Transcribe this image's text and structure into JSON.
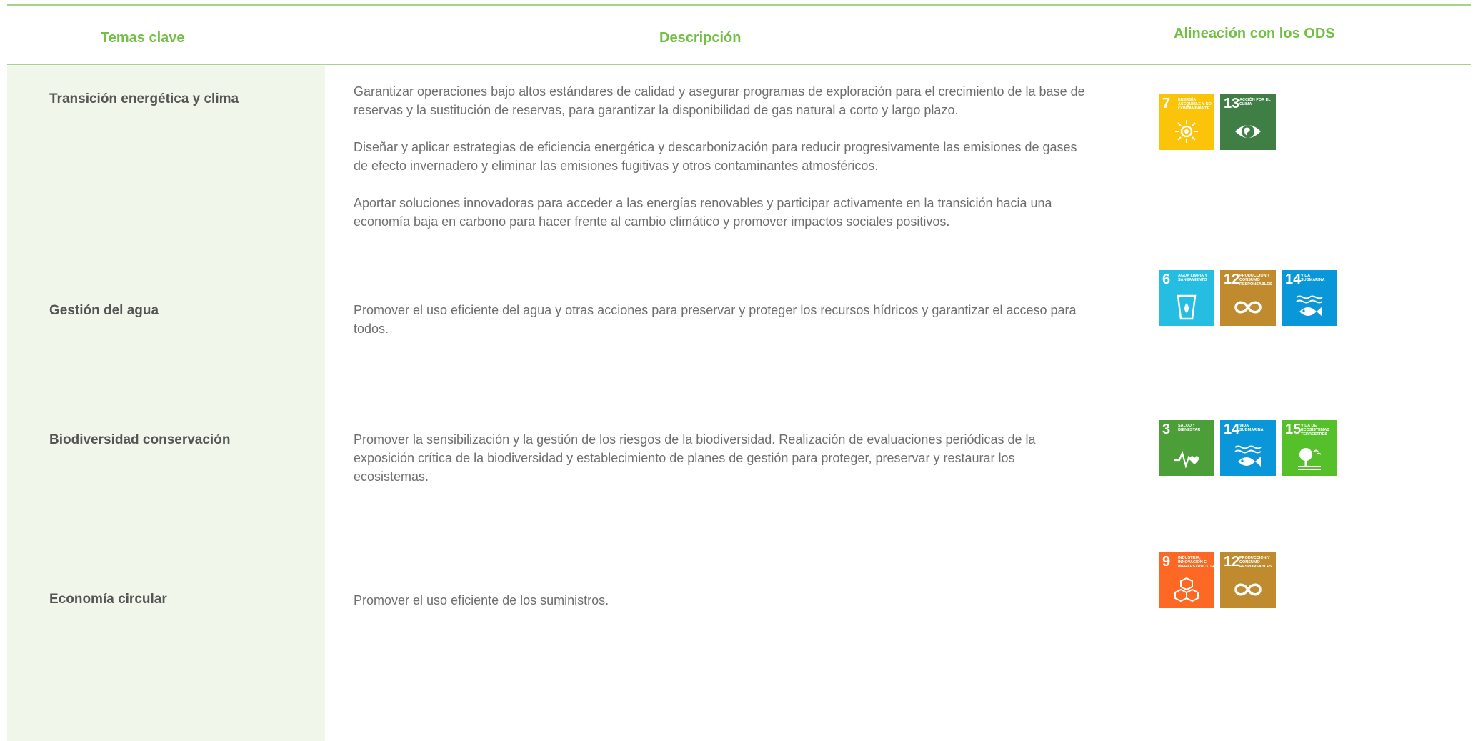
{
  "headers": {
    "themes": "Temas clave",
    "description": "Descripción",
    "ods": "Alineación con los ODS"
  },
  "rows": [
    {
      "theme": "Transición energética y clima",
      "paragraphs": [
        "Garantizar operaciones bajo altos estándares de calidad y asegurar programas de exploración para el crecimiento de la base de reservas y la sustitución de reservas, para garantizar la disponibilidad de gas natural a corto y largo plazo.",
        "Diseñar y aplicar estrategias de eficiencia energética y descarbonización para reducir progresivamente las emisiones de gases de efecto invernadero y eliminar las emisiones fugitivas y otros contaminantes atmosféricos.",
        "Aportar soluciones innovadoras para acceder a las energías renovables y participar activamente en la transición hacia una economía baja en carbono para hacer frente al cambio climático y promover impactos sociales positivos."
      ],
      "sdgs": [
        {
          "num": "7",
          "label": "Energía asequible y no contaminante",
          "color": "#fcc30b",
          "icon": "sun-icon"
        },
        {
          "num": "13",
          "label": "Acción por el clima",
          "color": "#3f7e44",
          "icon": "eye-earth-icon"
        }
      ]
    },
    {
      "theme": "Gestión del agua",
      "paragraphs": [
        "Promover el uso eficiente del agua y otras acciones para preservar y proteger los recursos hídricos y garantizar el acceso para todos."
      ],
      "sdgs": [
        {
          "num": "6",
          "label": "Agua limpia y saneamiento",
          "color": "#26bde2",
          "icon": "water-glass-icon"
        },
        {
          "num": "12",
          "label": "Producción y consumo responsables",
          "color": "#bf8b2e",
          "icon": "infinity-icon"
        },
        {
          "num": "14",
          "label": "Vida submarina",
          "color": "#0a97d9",
          "icon": "fish-icon"
        }
      ]
    },
    {
      "theme": "Biodiversidad conservación",
      "paragraphs": [
        "Promover la sensibilización y la gestión de los riesgos de la biodiversidad. Realización de evaluaciones periódicas de la exposición crítica de la biodiversidad y establecimiento de planes de gestión para proteger, preservar y restaurar los ecosistemas."
      ],
      "sdgs": [
        {
          "num": "3",
          "label": "Salud y bienestar",
          "color": "#4c9f38",
          "icon": "heartbeat-icon"
        },
        {
          "num": "14",
          "label": "Vida submarina",
          "color": "#0a97d9",
          "icon": "fish-icon"
        },
        {
          "num": "15",
          "label": "Vida de ecosistemas terrestres",
          "color": "#56c02b",
          "icon": "tree-icon"
        }
      ]
    },
    {
      "theme": "Economía circular",
      "paragraphs": [
        "Promover el uso eficiente de los suministros."
      ],
      "sdgs": [
        {
          "num": "9",
          "label": "Industria, innovación e infraestructura",
          "color": "#fd6925",
          "icon": "cubes-icon"
        },
        {
          "num": "12",
          "label": "Producción y consumo responsables",
          "color": "#bf8b2e",
          "icon": "infinity-icon"
        }
      ]
    }
  ]
}
